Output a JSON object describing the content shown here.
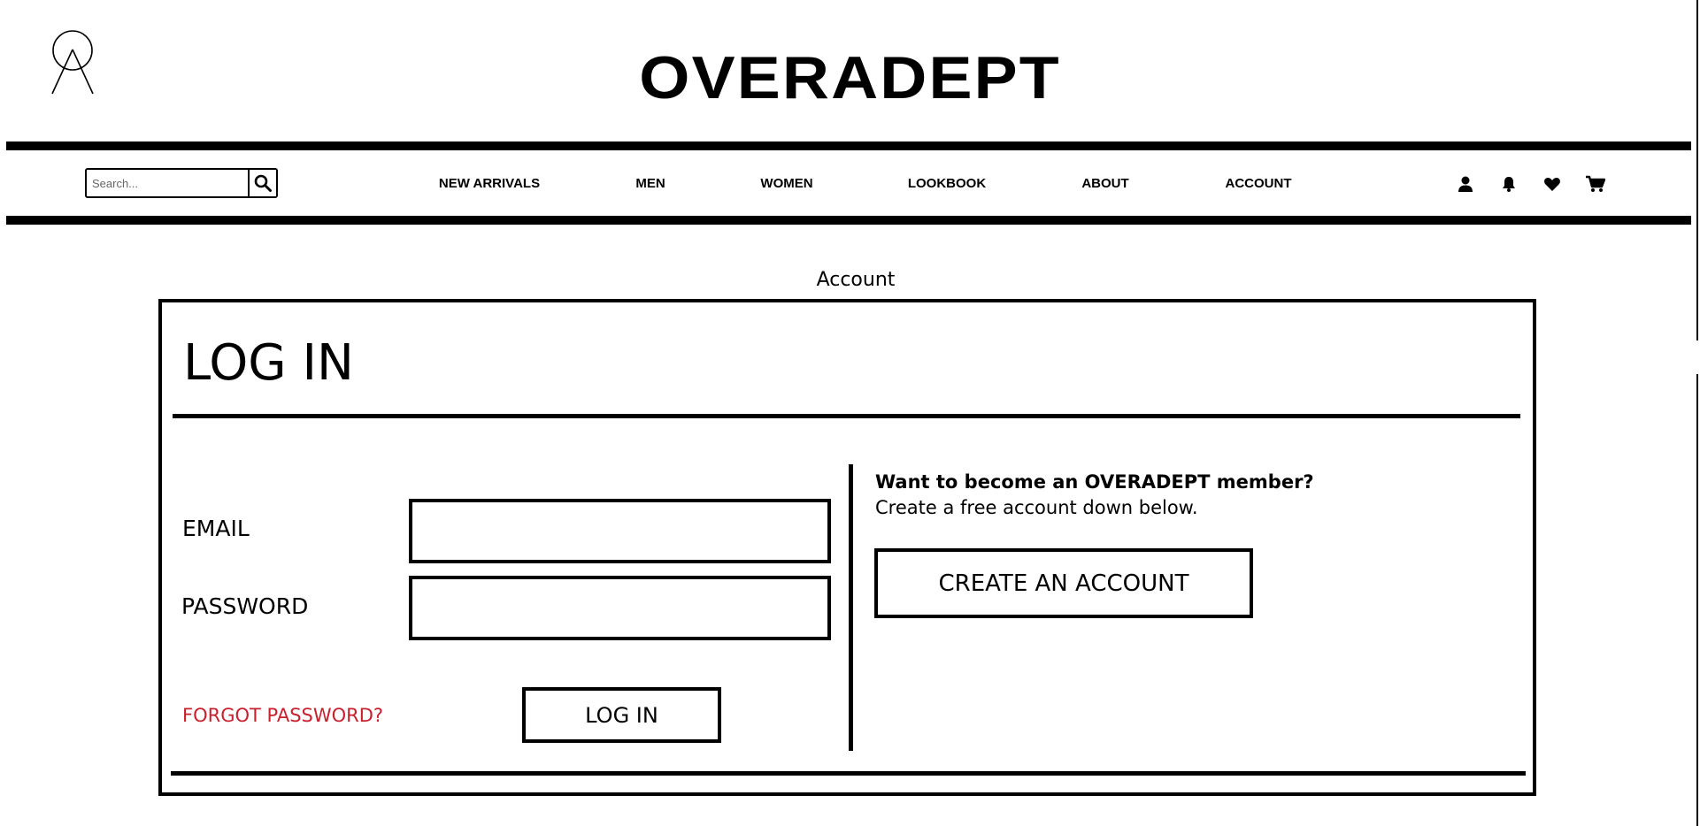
{
  "header": {
    "site_title": "OVERADEPT"
  },
  "search": {
    "placeholder": "Search...",
    "value": ""
  },
  "nav": {
    "items": [
      {
        "label": "NEW ARRIVALS"
      },
      {
        "label": "MEN"
      },
      {
        "label": "WOMEN"
      },
      {
        "label": "LOOKBOOK"
      },
      {
        "label": "ABOUT"
      },
      {
        "label": "ACCOUNT"
      }
    ],
    "icons": [
      "user-icon",
      "bell-icon",
      "heart-icon",
      "cart-icon"
    ]
  },
  "account": {
    "caption": "Account",
    "login": {
      "title": "LOG IN",
      "email_label": "EMAIL",
      "email_value": "",
      "password_label": "PASSWORD",
      "password_value": "",
      "forgot_label": "FORGOT PASSWORD?",
      "submit_label": "LOG IN"
    },
    "register": {
      "heading": "Want to become an OVERADEPT member?",
      "subtext": "Create a free account down below.",
      "button_label": "CREATE AN ACCOUNT"
    }
  },
  "colors": {
    "accent_link": "#c8202f",
    "text": "#000000",
    "background": "#ffffff"
  }
}
